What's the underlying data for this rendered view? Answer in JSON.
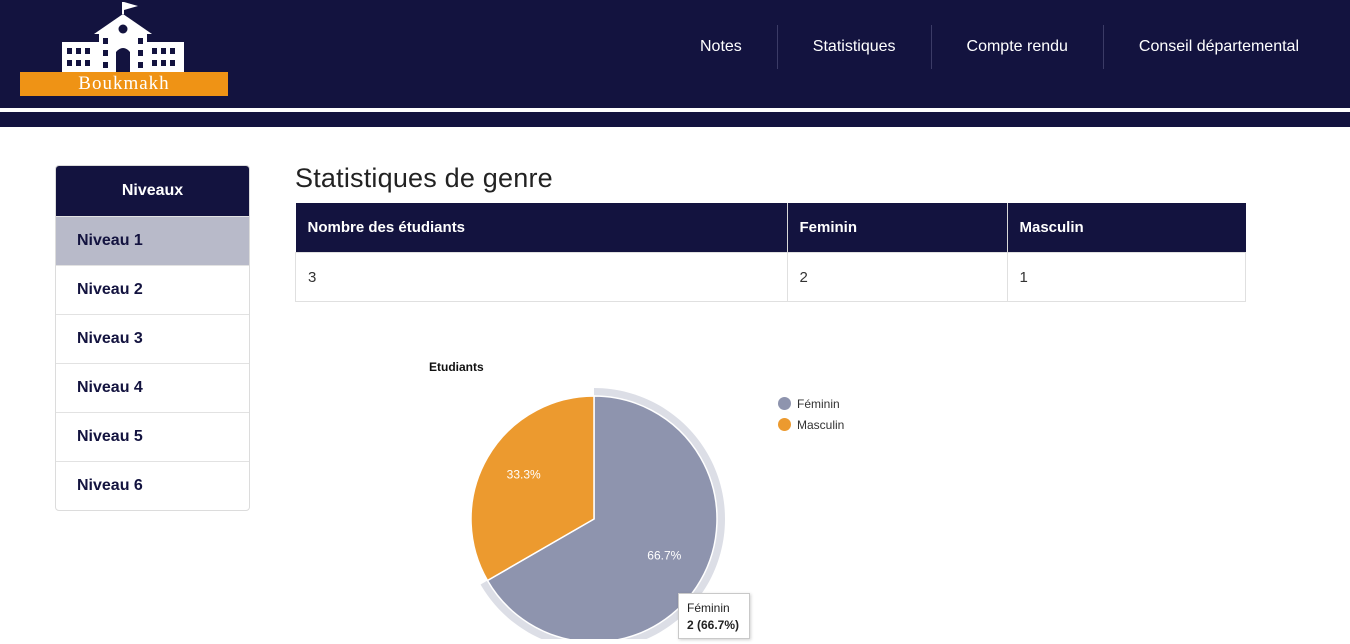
{
  "brand": {
    "name": "Boukmakh"
  },
  "nav": {
    "items": [
      "Notes",
      "Statistiques",
      "Compte rendu",
      "Conseil départemental"
    ]
  },
  "sidebar": {
    "title": "Niveaux",
    "items": [
      "Niveau 1",
      "Niveau 2",
      "Niveau 3",
      "Niveau 4",
      "Niveau 5",
      "Niveau 6"
    ],
    "active_index": 0
  },
  "main": {
    "title": "Statistiques de genre",
    "table": {
      "headers": [
        "Nombre des étudiants",
        "Feminin",
        "Masculin"
      ],
      "rows": [
        [
          "3",
          "2",
          "1"
        ]
      ]
    }
  },
  "colors": {
    "navbar": "#13133f",
    "accent_orange": "#ef9315",
    "feminin": "#8e94ae",
    "masculin": "#ec9a2f",
    "active_item": "#b8bac9"
  },
  "chart_data": {
    "type": "pie",
    "title": "Etudiants",
    "categories": [
      "Féminin",
      "Masculin"
    ],
    "values": [
      2,
      1
    ],
    "data_labels": [
      "66.7%",
      "33.3%"
    ],
    "legend_placement": "top-right",
    "highlighted": "Féminin",
    "tooltip": {
      "label": "Féminin",
      "value": "2 (66.7%)"
    }
  }
}
